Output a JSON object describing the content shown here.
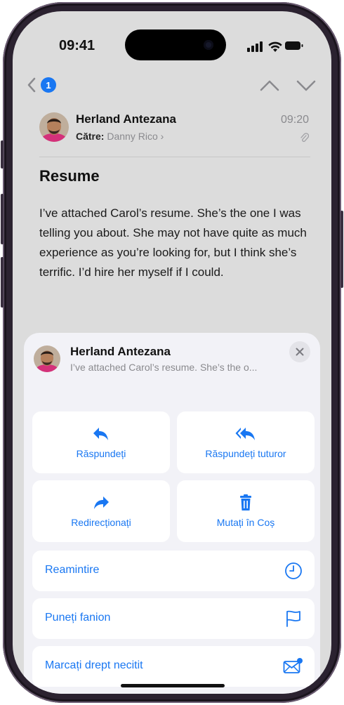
{
  "status_bar": {
    "time": "09:41"
  },
  "nav": {
    "unread_count": "1"
  },
  "message": {
    "sender": "Herland Antezana",
    "to_label": "Către:",
    "recipient": "Danny Rico",
    "time": "09:20",
    "subject": "Resume",
    "body": "I’ve attached Carol’s resume. She’s the one I was telling you about. She may not have quite as much experience as you’re looking for, but I think she’s terrific. I’d hire her myself if I could."
  },
  "sheet": {
    "sender": "Herland Antezana",
    "preview": "I’ve attached Carol’s resume. She’s the o...",
    "tiles": [
      {
        "label": "Răspundeți",
        "icon": "reply-icon"
      },
      {
        "label": "Răspundeți tuturor",
        "icon": "reply-all-icon"
      },
      {
        "label": "Redirecționați",
        "icon": "forward-icon"
      },
      {
        "label": "Mutați în Coș",
        "icon": "trash-icon"
      }
    ],
    "rows": [
      {
        "label": "Reamintire",
        "icon": "clock-icon"
      },
      {
        "label": "Puneți fanion",
        "icon": "flag-icon"
      },
      {
        "label": "Marcați drept necitit",
        "icon": "unread-envelope-icon"
      }
    ]
  },
  "colors": {
    "accent": "#1977f2",
    "sheet_bg": "#f2f2f7",
    "screen_bg": "#dcdcdc"
  }
}
